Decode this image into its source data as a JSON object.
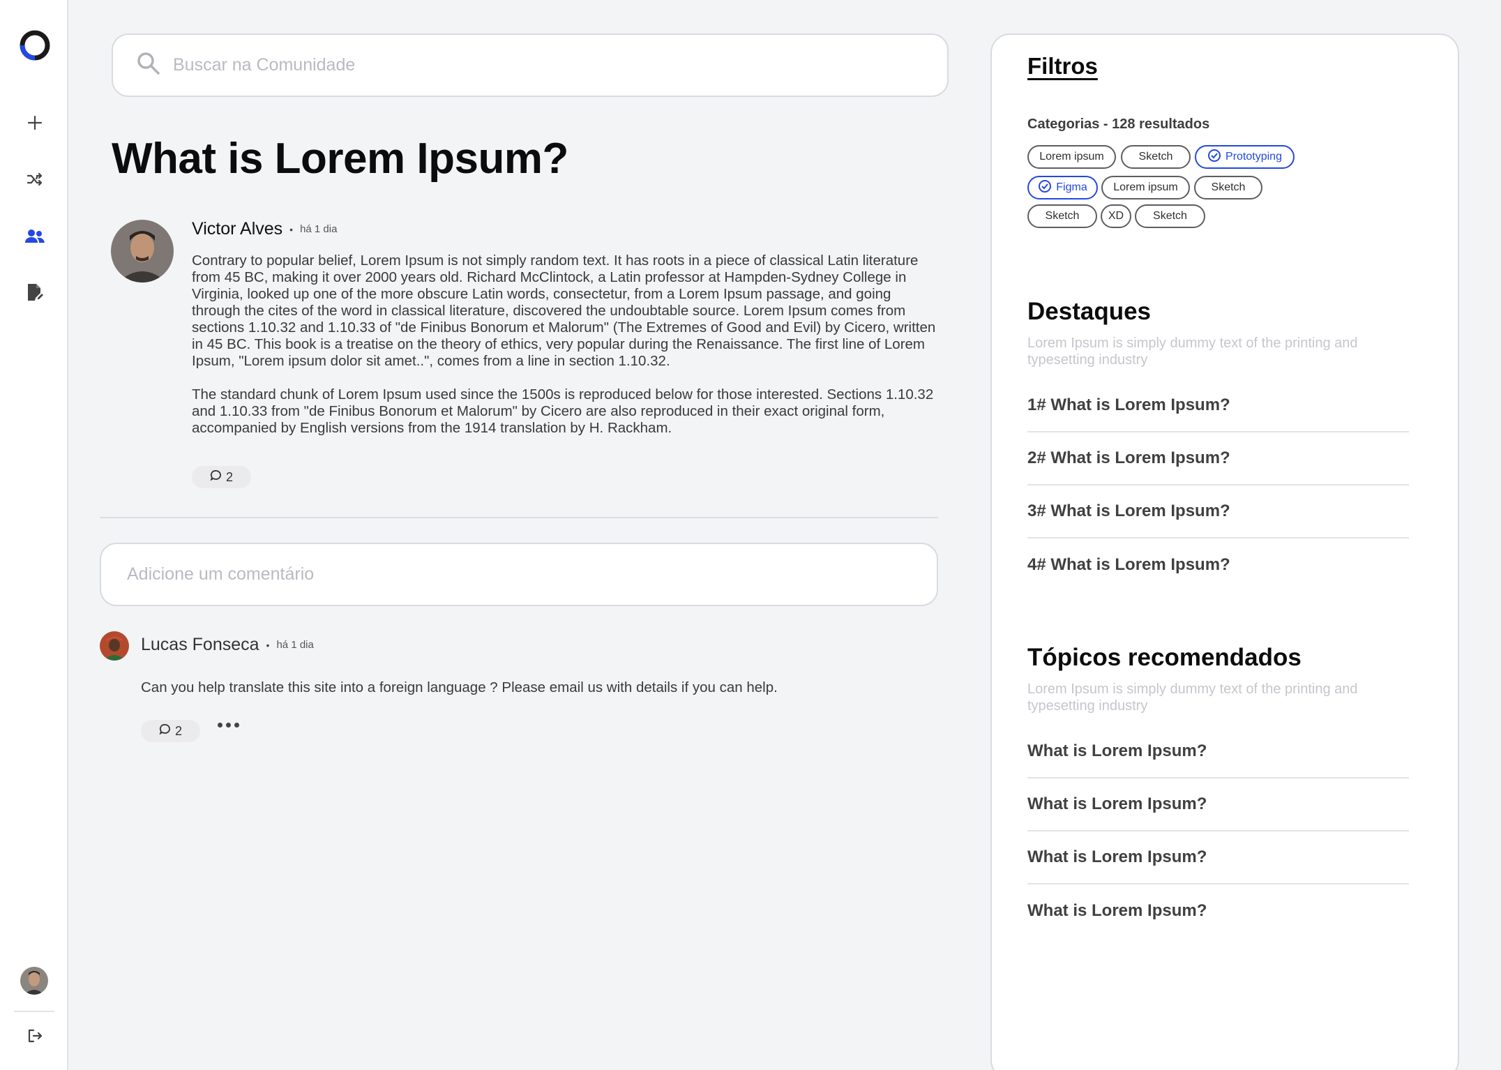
{
  "search": {
    "placeholder": "Buscar na Comunidade"
  },
  "page_title": "What is Lorem Ipsum?",
  "post": {
    "author": "Victor Alves",
    "time": "há 1 dia",
    "paragraph1": "Contrary to popular belief, Lorem Ipsum is not simply random text. It has roots in a piece of classical Latin literature from 45 BC, making it over 2000 years old. Richard McClintock, a Latin professor at Hampden-Sydney College in Virginia, looked up one of the more obscure Latin words, consectetur, from a Lorem Ipsum passage, and going through the cites of the word in classical literature, discovered the undoubtable source. Lorem Ipsum comes from sections 1.10.32 and 1.10.33 of \"de Finibus Bonorum et Malorum\" (The Extremes of Good and Evil) by Cicero, written in 45 BC. This book is a treatise on the theory of ethics, very popular during the Renaissance. The first line of Lorem Ipsum, \"Lorem ipsum dolor sit amet..\", comes from a line in section 1.10.32.",
    "paragraph2": "The standard chunk of Lorem Ipsum used since the 1500s is reproduced below for those interested. Sections 1.10.32 and 1.10.33 from \"de Finibus Bonorum et Malorum\" by Cicero are also reproduced in their exact original form, accompanied by English versions from the 1914 translation by H. Rackham.",
    "comment_count": "2"
  },
  "comment_input": {
    "placeholder": "Adicione um comentário"
  },
  "comment": {
    "author": "Lucas Fonseca",
    "time": "há 1 dia",
    "text": "Can you help translate this site into a foreign language ? Please email us with details if you can help.",
    "reply_count": "2"
  },
  "filters": {
    "title": "Filtros",
    "categories_label": "Categorias - 128 resultados",
    "tags": [
      "Lorem ipsum",
      "Sketch",
      "Prototyping",
      "Figma",
      "Lorem ipsum",
      "Sketch",
      "Sketch",
      "XD",
      "Sketch"
    ],
    "selected_tags": [
      "Prototyping",
      "Figma"
    ]
  },
  "highlights": {
    "title": "Destaques",
    "subtitle": "Lorem Ipsum is simply dummy text of the printing and typesetting industry",
    "items": [
      "1# What is Lorem Ipsum?",
      "2# What is Lorem Ipsum?",
      "3# What is Lorem Ipsum?",
      "4# What is Lorem Ipsum?"
    ]
  },
  "recommended": {
    "title": "Tópicos recomendados",
    "subtitle": "Lorem Ipsum is simply dummy text of the printing and typesetting industry",
    "items": [
      "What is Lorem Ipsum?",
      "What is Lorem Ipsum?",
      "What is Lorem Ipsum?",
      "What is Lorem Ipsum?"
    ]
  },
  "colors": {
    "accent": "#2448e0",
    "background": "#f3f4f6",
    "panel": "#ffffff",
    "muted": "#c5c6cc"
  },
  "icons": [
    "logo-ring",
    "plus-icon",
    "shuffle-icon",
    "community-icon",
    "edit-document-icon",
    "logout-icon",
    "search-icon",
    "comment-icon",
    "more-icon",
    "check-badge-icon"
  ]
}
